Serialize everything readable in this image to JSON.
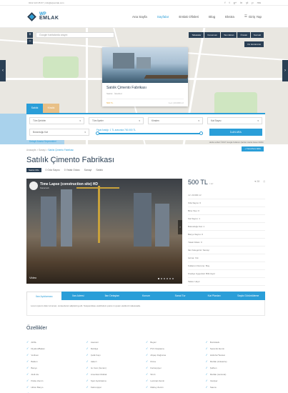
{
  "topbar": {
    "contact": "0212 123 45 67  |  info@wpemlak.com",
    "social": [
      "f",
      "t",
      "g+",
      "in",
      "yt",
      "p",
      "rss"
    ]
  },
  "logo": {
    "line1": "WP",
    "line2": "EMLAK"
  },
  "nav": {
    "items": [
      "Ana Sayfa",
      "Sayfalar",
      "Emlak Ofisleri",
      "Blog",
      "Ekstra"
    ],
    "active_index": 1,
    "login": "Giriş Yap"
  },
  "map": {
    "search_placeholder": "Google haritalarda arayın",
    "tools": [
      "Tabakalar",
      "Konumum",
      "Tam Ekran",
      "Önceki",
      "Sonraki"
    ],
    "location": "Yol Görünümü",
    "footer": "Harita verileri ©2017 Google   Kullanım Şartları   Harita hatası bildirin",
    "popup": {
      "title": "Satılık Çimento Fabrikası",
      "meta": "Satılık · İstanbul",
      "price": "500 TL",
      "info": "1+1  |  23.000 m²"
    }
  },
  "search": {
    "tab1": "Satılık",
    "tab2": "Kiralık",
    "row1": [
      "Tüm Şehirler",
      "Tüm İlçeler",
      "Kimden",
      "Kat Sayısı"
    ],
    "row2": [
      "Bulunduğu Kat"
    ],
    "range_label": "Fiyat Aralığı: 1 TL arasında 700.000 TL",
    "button": "İLAN ARA",
    "advanced": "Detaylı Arama Seçenekleri",
    "favorites": "+ Favorilere Ekle"
  },
  "crumbs": {
    "home": "Anasayfa",
    "sep": ">",
    "mid": "Sanayi",
    "current": "Satılık Çimento Fabrikası"
  },
  "listing": {
    "title": "Satılık Çimento Fabrikası",
    "badge": "Satılık Ofis",
    "meta": [
      "0 Oda Sayısı",
      "0 Yatak Odası",
      "Sanayi",
      "Satılık"
    ],
    "price": "500 TL",
    "price_unit": "/ m²",
    "views": "28",
    "details": [
      "m²: 23.000 m²",
      "Oda Sayısı: 0",
      "Bina Yaşı: 0",
      "Kat Sayısı: 1",
      "Bulunduğu Kat: 1",
      "Banyo Sayısı: 0",
      "Yatak Odası: 0",
      "İlan Kategorisi: Sanayi",
      "Isıtma: Yok",
      "Kullanım Durumu: Boş",
      "Krediye Uygunluk: Bilinmiyor",
      "Takas: Hayır"
    ]
  },
  "video": {
    "title": "Time Lapse (construction site) HD",
    "channel": "Kanal adı",
    "label": "Video"
  },
  "detail_tabs": {
    "items": [
      "İlan Açıklaması",
      "İlan Adresi",
      "İlan Detayları",
      "Konum",
      "Sanal Tur",
      "Kat Planları",
      "Sayfa Görüntüleme"
    ],
    "active_index": 0,
    "body": "Lorem ipsum dolor sit amet, consectetur adipiscing elit. Suspendisse vestibulum purus in quam eleifend malesuada."
  },
  "features": {
    "title": "Özellikler",
    "items": [
      "ADSL",
      "Asansör",
      "Beyaz",
      "Buzdolabı",
      "Diyafon/Bakan",
      "Mobilya",
      "PVC Doğrama",
      "Seramik Zemin",
      "Verilsen",
      "Çelik Kapı",
      "Ahşap Doğrama",
      "Hidrofor/Tesisat",
      "Balkon",
      "Jakuzi",
      "Klima",
      "Mutfak (Ankastre)",
      "Banyo",
      "Isı Cam (İsıcam)",
      "Kartonpiyer",
      "Şofben",
      "Akıllı Ev",
      "Amerikan Mutfak",
      "Wi-Fi",
      "Mutfak (Laminat)",
      "Parke Zemin",
      "Spot Aydınlatma",
      "Laminat Zemin",
      "Vestiyer",
      "Hilton Banyo",
      "Kartonpiyer",
      "Marley Zemin",
      "Sauna",
      "Teras"
    ]
  }
}
